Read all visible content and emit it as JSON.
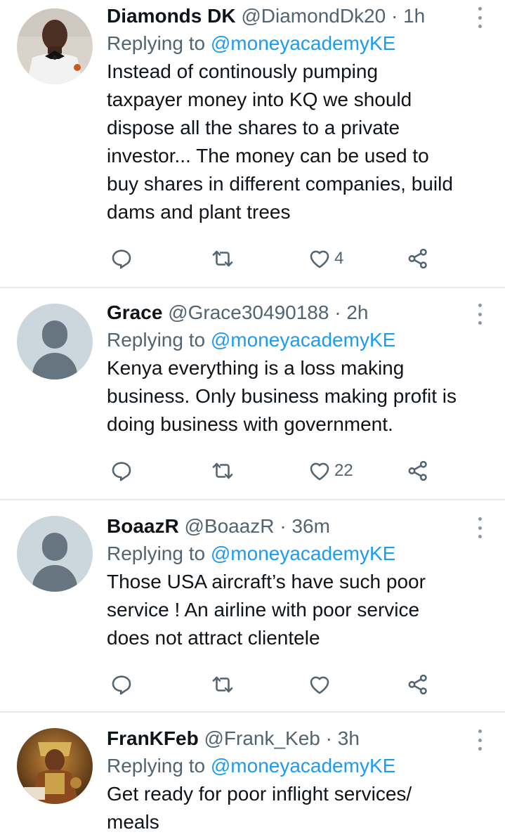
{
  "tweets": [
    {
      "name": "Diamonds DK",
      "handle": "@DiamondDk20",
      "separator": "·",
      "time": "1h",
      "replying_prefix": "Replying to",
      "replying_to": "@moneyacademyKE",
      "lines": [
        "Instead of continously pumping",
        "taxpayer money into KQ we should",
        "dispose all the shares to a private",
        "investor... The money can be used to",
        "buy shares in different companies, build",
        "dams and plant trees"
      ],
      "like_count": "4",
      "avatar": "photo"
    },
    {
      "name": "Grace",
      "handle": "@Grace30490188",
      "separator": "·",
      "time": "2h",
      "replying_prefix": "Replying to",
      "replying_to": "@moneyacademyKE",
      "lines": [
        "Kenya everything is a loss making",
        "business. Only business making profit is",
        "doing business with government."
      ],
      "like_count": "22",
      "avatar": "default-profile"
    },
    {
      "name": "BoaazR",
      "handle": "@BoaazR",
      "separator": "·",
      "time": "36m",
      "replying_prefix": "Replying to",
      "replying_to": "@moneyacademyKE",
      "lines": [
        "Those USA aircraft’s have such poor",
        "service ! An airline with poor service",
        "does not attract clientele"
      ],
      "like_count": "",
      "avatar": "default-profile"
    },
    {
      "name": "FranKFeb",
      "handle": "@Frank_Keb",
      "separator": "·",
      "time": "3h",
      "replying_prefix": "Replying to",
      "replying_to": "@moneyacademyKE",
      "lines": [
        "Get ready for poor inflight services/",
        "meals"
      ],
      "like_count": "",
      "avatar": "artwork"
    }
  ],
  "icons": {
    "reply": "reply-icon",
    "retweet": "retweet-icon",
    "like": "heart-icon",
    "share": "share-icon",
    "more": "more-options-icon"
  },
  "colors": {
    "text": "#0f1419",
    "secondary": "#536471",
    "link": "#1d9bf0",
    "divider": "#e7e9ea",
    "default_avatar_bg": "#ccd6dd"
  }
}
